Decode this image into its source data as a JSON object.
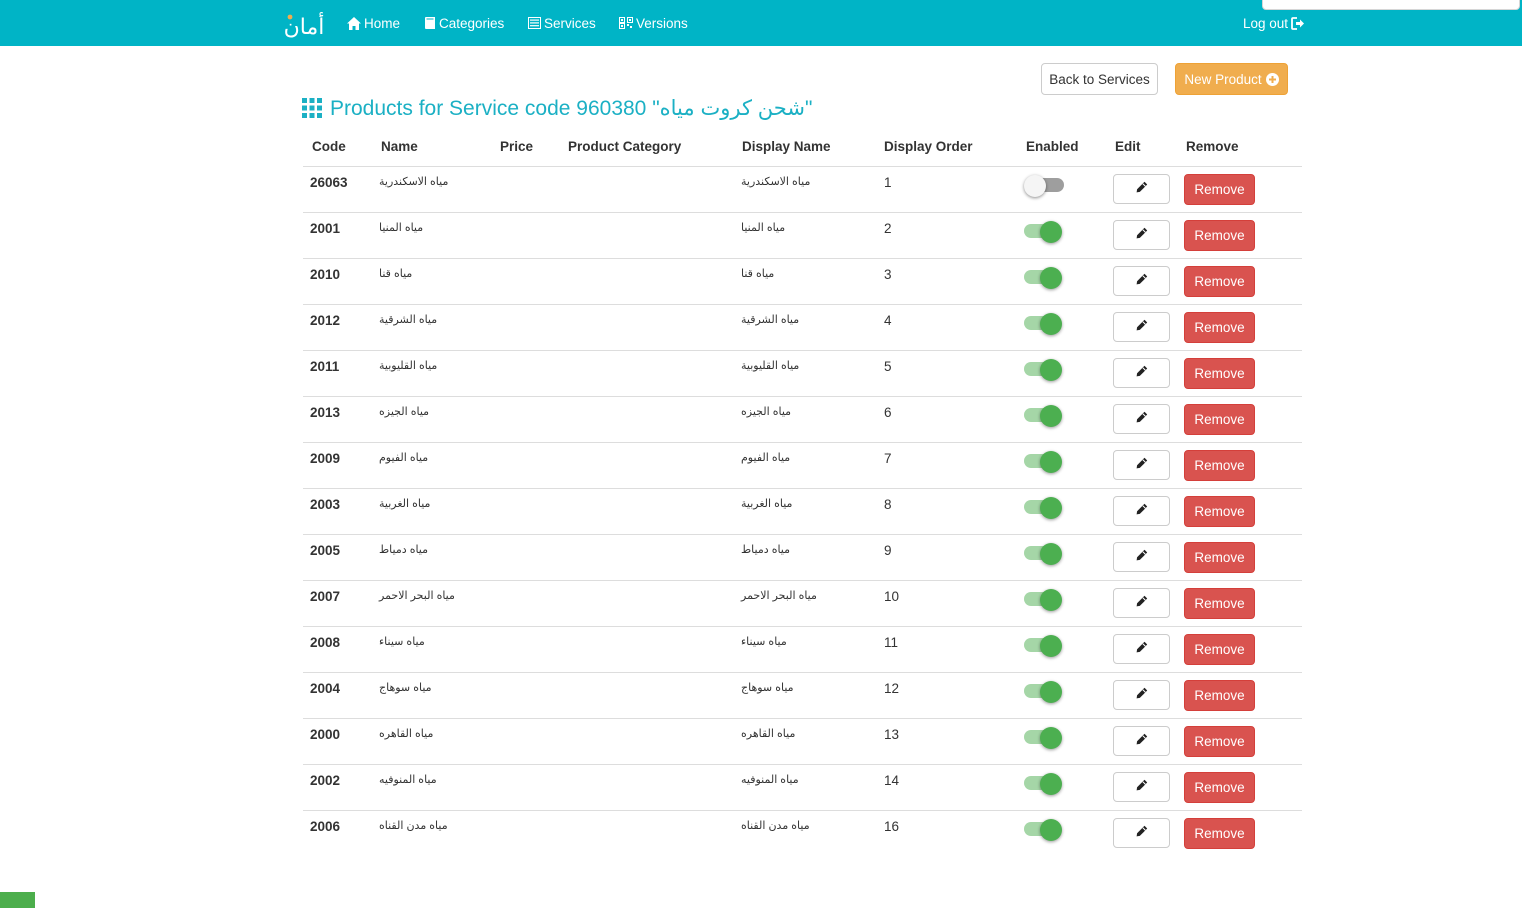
{
  "nav": {
    "brand": "أمان",
    "items": [
      {
        "label": "Home",
        "icon": "home-icon"
      },
      {
        "label": "Categories",
        "icon": "book-icon"
      },
      {
        "label": "Services",
        "icon": "list-icon"
      },
      {
        "label": "Versions",
        "icon": "barcode-icon"
      }
    ],
    "logout": "Log out"
  },
  "actions": {
    "back": "Back to Services",
    "new_product": "New Product"
  },
  "page": {
    "title": "Products for Service code 960380 \"شحن كروت مياه\""
  },
  "table": {
    "headers": [
      "Code",
      "Name",
      "Price",
      "Product Category",
      "Display Name",
      "Display Order",
      "Enabled",
      "Edit",
      "Remove"
    ],
    "remove_label": "Remove",
    "rows": [
      {
        "code": "26063",
        "name": "مياه الاسكندرية",
        "price": "",
        "category": "",
        "display_name": "مياه الاسكندرية",
        "order": "1",
        "enabled": false
      },
      {
        "code": "2001",
        "name": "مياه المنيا",
        "price": "",
        "category": "",
        "display_name": "مياه المنيا",
        "order": "2",
        "enabled": true
      },
      {
        "code": "2010",
        "name": "مياه قنا",
        "price": "",
        "category": "",
        "display_name": "مياه قنا",
        "order": "3",
        "enabled": true
      },
      {
        "code": "2012",
        "name": "مياه الشرقية",
        "price": "",
        "category": "",
        "display_name": "مياه الشرقية",
        "order": "4",
        "enabled": true
      },
      {
        "code": "2011",
        "name": "مياه القليوبية",
        "price": "",
        "category": "",
        "display_name": "مياه القليوبية",
        "order": "5",
        "enabled": true
      },
      {
        "code": "2013",
        "name": "مياه الجيزه",
        "price": "",
        "category": "",
        "display_name": "مياه الجيزه",
        "order": "6",
        "enabled": true
      },
      {
        "code": "2009",
        "name": "مياه الفيوم",
        "price": "",
        "category": "",
        "display_name": "مياه الفيوم",
        "order": "7",
        "enabled": true
      },
      {
        "code": "2003",
        "name": "مياه الغربية",
        "price": "",
        "category": "",
        "display_name": "مياه الغربية",
        "order": "8",
        "enabled": true
      },
      {
        "code": "2005",
        "name": "مياه دمياط",
        "price": "",
        "category": "",
        "display_name": "مياه دمياط",
        "order": "9",
        "enabled": true
      },
      {
        "code": "2007",
        "name": "مياه البحر الاحمر",
        "price": "",
        "category": "",
        "display_name": "مياه البحر الاحمر",
        "order": "10",
        "enabled": true
      },
      {
        "code": "2008",
        "name": "مياه سيناء",
        "price": "",
        "category": "",
        "display_name": "مياه سيناء",
        "order": "11",
        "enabled": true
      },
      {
        "code": "2004",
        "name": "مياه سوهاج",
        "price": "",
        "category": "",
        "display_name": "مياه سوهاج",
        "order": "12",
        "enabled": true
      },
      {
        "code": "2000",
        "name": "مياه القاهره",
        "price": "",
        "category": "",
        "display_name": "مياه القاهره",
        "order": "13",
        "enabled": true
      },
      {
        "code": "2002",
        "name": "مياه المنوفيه",
        "price": "",
        "category": "",
        "display_name": "مياه المنوفيه",
        "order": "14",
        "enabled": true
      },
      {
        "code": "2006",
        "name": "مياه مدن القناه",
        "price": "",
        "category": "",
        "display_name": "مياه مدن القناه",
        "order": "16",
        "enabled": true
      }
    ]
  },
  "colors": {
    "navbar": "#00b4c6",
    "title": "#1bb0c4",
    "warning": "#f0ad4e",
    "danger": "#d9534f",
    "toggle_on": "#4caf50"
  }
}
